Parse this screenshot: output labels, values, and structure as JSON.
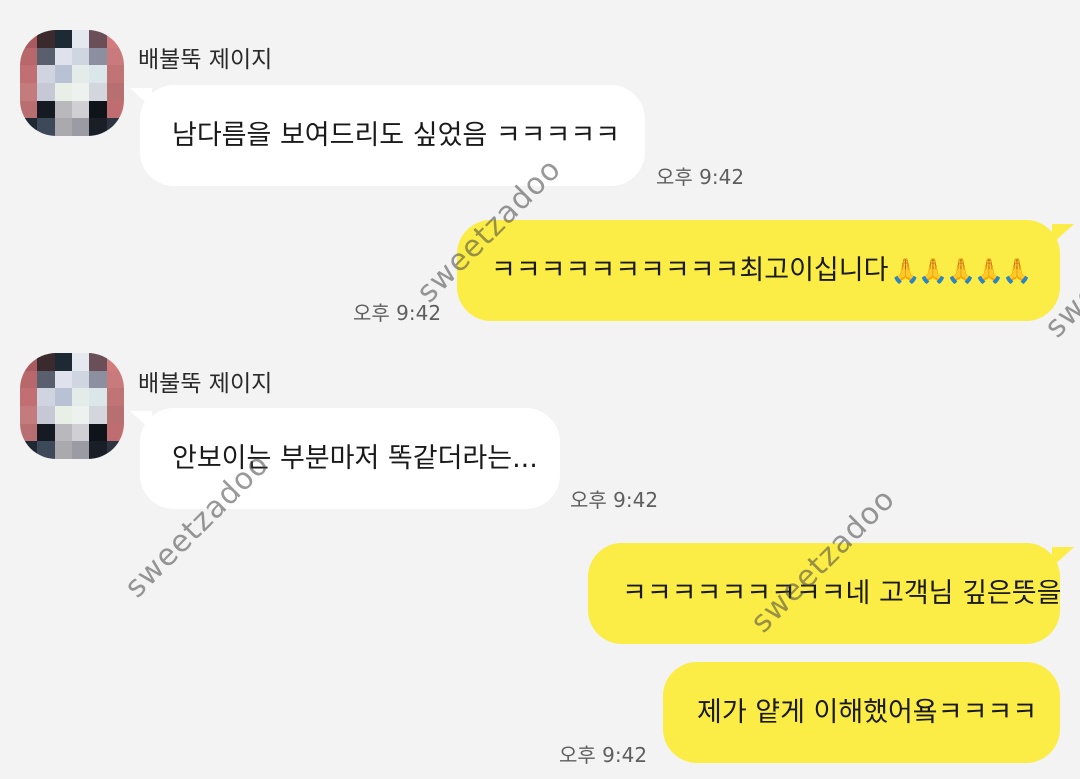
{
  "messages": [
    {
      "sender": "배불뚝 제이지",
      "text": "남다름을 보여드리도 싶었음 ㅋㅋㅋㅋㅋ",
      "time": "오후 9:42",
      "direction": "incoming"
    },
    {
      "text": "ㅋㅋㅋㅋㅋㅋㅋㅋㅋㅋ최고이십니다",
      "emoji": "🙏🙏🙏🙏🙏",
      "time": "오후 9:42",
      "direction": "outgoing"
    },
    {
      "sender": "배불뚝 제이지",
      "text": "안보이는 부분마저 똑같더라는...",
      "time": "오후 9:42",
      "direction": "incoming"
    },
    {
      "text": "ㅋㅋㅋㅋㅋㅋㅋㅋㅋ네 고객님 깊은뜻을",
      "direction": "outgoing"
    },
    {
      "text": "제가 얕게 이해했어욬ㅋㅋㅋㅋ",
      "time": "오후 9:42",
      "direction": "outgoing"
    }
  ],
  "watermark": "sweetzadoo",
  "colors": {
    "background": "#f3f3f3",
    "incoming_bubble": "#ffffff",
    "outgoing_bubble": "#fbec46",
    "time_text": "#5e5e5e"
  },
  "icons": [
    "avatar-mosaic"
  ]
}
